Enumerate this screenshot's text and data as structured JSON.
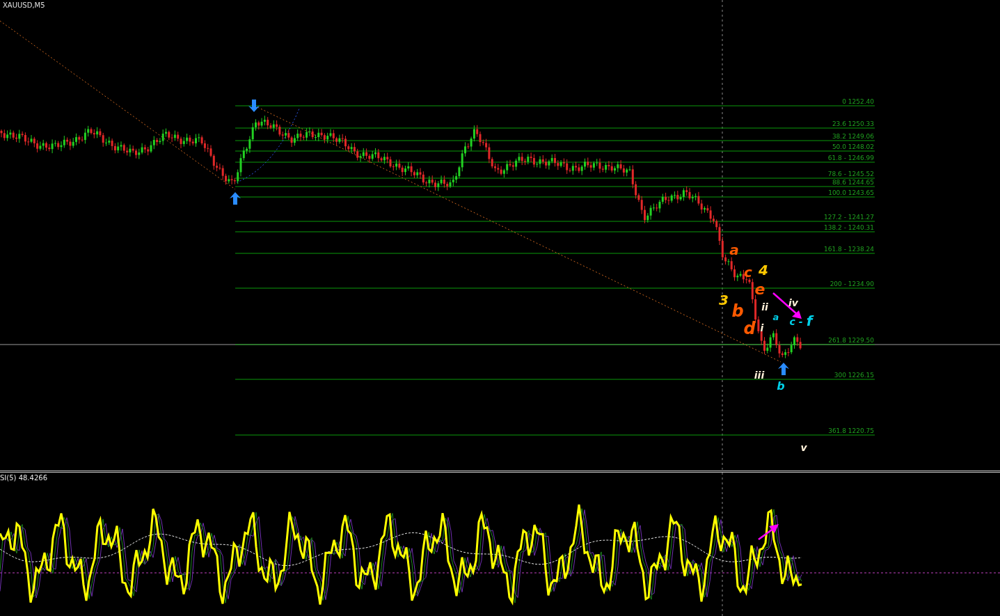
{
  "chart": {
    "symbol": "XAUUSD,M5",
    "fib_levels": [
      {
        "label": "0 1252.40"
      },
      {
        "label": "23.6 1250.33"
      },
      {
        "label": "38.2 1249.06"
      },
      {
        "label": "50.0 1248.02"
      },
      {
        "label": "61.8 - 1246.99"
      },
      {
        "label": "78.6 - 1245.52"
      },
      {
        "label": "88.6 1244.65"
      },
      {
        "label": "100.0 1243.65"
      },
      {
        "label": "127.2 - 1241.27"
      },
      {
        "label": "138.2 - 1240.31"
      },
      {
        "label": "161.8 -  1238.24"
      },
      {
        "label": "200 - 1234.90"
      },
      {
        "label": "261.8 1229.50"
      },
      {
        "label": "300 1226.15"
      },
      {
        "label": "361.8 1220.75"
      }
    ],
    "wave_labels": [
      {
        "text": "a",
        "color": "#ff5a00"
      },
      {
        "text": "c",
        "color": "#ff5a00"
      },
      {
        "text": "4",
        "color": "#ffc800"
      },
      {
        "text": "e",
        "color": "#ff5a00"
      },
      {
        "text": "3",
        "color": "#ffc800"
      },
      {
        "text": "b",
        "color": "#ff5a00"
      },
      {
        "text": "ii",
        "color": "#fff0d8"
      },
      {
        "text": "iv",
        "color": "#fff0d8"
      },
      {
        "text": "a",
        "color": "#00d0e8"
      },
      {
        "text": "c -",
        "color": "#00d0e8"
      },
      {
        "text": "f",
        "color": "#00d0e8"
      },
      {
        "text": "d",
        "color": "#ff5a00"
      },
      {
        "text": "i",
        "color": "#fff0d8"
      },
      {
        "text": "iii",
        "color": "#fff0d8"
      },
      {
        "text": "b",
        "color": "#00d0e8"
      },
      {
        "text": "v",
        "color": "#fff0d8"
      }
    ]
  },
  "indicator": {
    "label": "SI(5) 48.4266"
  }
}
